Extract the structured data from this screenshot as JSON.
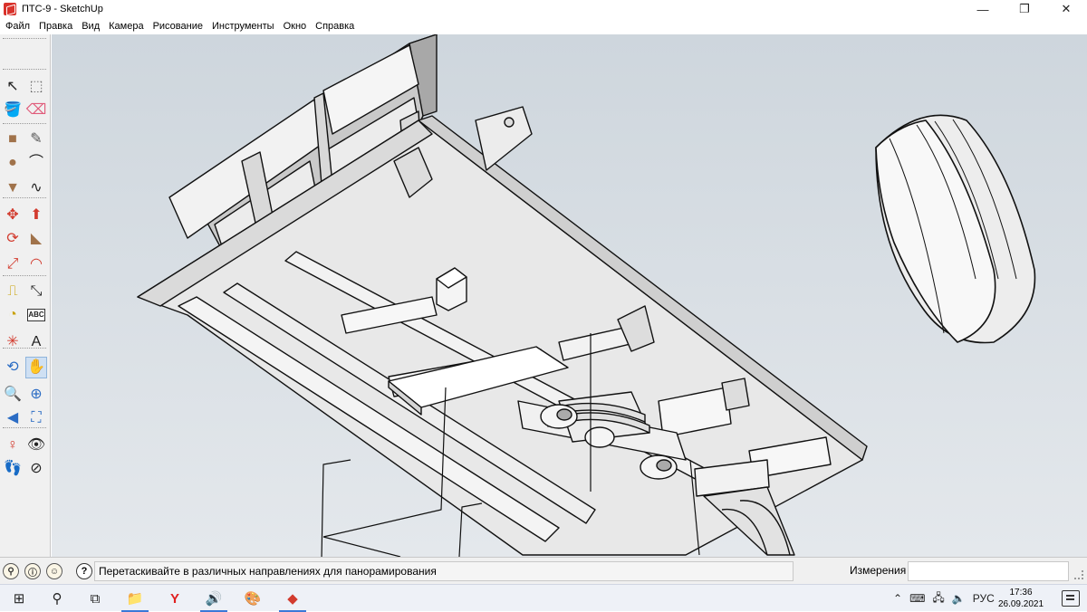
{
  "window": {
    "title": "ПТС-9 - SketchUp",
    "minimize_glyph": "—",
    "maximize_glyph": "❐",
    "close_glyph": "✕"
  },
  "menu": {
    "items": [
      "Файл",
      "Правка",
      "Вид",
      "Камера",
      "Рисование",
      "Инструменты",
      "Окно",
      "Справка"
    ]
  },
  "toolbar": {
    "tools": [
      {
        "name": "select-icon",
        "glyph": "↖",
        "color": "#222222"
      },
      {
        "name": "make-component-icon",
        "glyph": "⬚",
        "color": "#666666"
      },
      {
        "name": "paint-bucket-icon",
        "glyph": "🪣",
        "color": "#c8a000"
      },
      {
        "name": "eraser-icon",
        "glyph": "⌫",
        "color": "#e05b7a"
      },
      {
        "name": "rectangle-icon",
        "glyph": "■",
        "color": "#a0724a"
      },
      {
        "name": "line-pencil-icon",
        "glyph": "✎",
        "color": "#555555"
      },
      {
        "name": "circle-icon",
        "glyph": "●",
        "color": "#a0724a"
      },
      {
        "name": "arc-icon",
        "glyph": "⌒",
        "color": "#222222"
      },
      {
        "name": "polygon-icon",
        "glyph": "▼",
        "color": "#a0724a"
      },
      {
        "name": "freehand-icon",
        "glyph": "∿",
        "color": "#222222"
      },
      {
        "name": "move-icon",
        "glyph": "✥",
        "color": "#d23b2e"
      },
      {
        "name": "push-pull-icon",
        "glyph": "⬆",
        "color": "#d23b2e"
      },
      {
        "name": "rotate-icon",
        "glyph": "⟳",
        "color": "#d23b2e"
      },
      {
        "name": "follow-me-icon",
        "glyph": "◣",
        "color": "#a0724a"
      },
      {
        "name": "scale-icon",
        "glyph": "⤢",
        "color": "#d23b2e"
      },
      {
        "name": "offset-icon",
        "glyph": "◠",
        "color": "#d23b2e"
      },
      {
        "name": "tape-measure-icon",
        "glyph": "⎍",
        "color": "#c8a000"
      },
      {
        "name": "dimension-icon",
        "glyph": "⤡",
        "color": "#222222"
      },
      {
        "name": "protractor-icon",
        "glyph": "◔",
        "color": "#c8a000"
      },
      {
        "name": "text-icon",
        "glyph": "ABC",
        "color": "#222222"
      },
      {
        "name": "axes-icon",
        "glyph": "✳",
        "color": "#d23b2e"
      },
      {
        "name": "3d-text-icon",
        "glyph": "A",
        "color": "#222222"
      },
      {
        "name": "orbit-icon",
        "glyph": "⟲",
        "color": "#2b6cc4"
      },
      {
        "name": "pan-icon",
        "glyph": "✋",
        "color": "#222222"
      },
      {
        "name": "zoom-icon",
        "glyph": "🔍",
        "color": "#2b6cc4"
      },
      {
        "name": "zoom-window-icon",
        "glyph": "⊕",
        "color": "#2b6cc4"
      },
      {
        "name": "previous-view-icon",
        "glyph": "◀",
        "color": "#2b6cc4"
      },
      {
        "name": "zoom-extents-icon",
        "glyph": "⛶",
        "color": "#2b6cc4"
      },
      {
        "name": "position-camera-icon",
        "glyph": "♀",
        "color": "#d23b2e"
      },
      {
        "name": "look-around-icon",
        "glyph": "👁",
        "color": "#222222"
      },
      {
        "name": "walk-icon",
        "glyph": "👣",
        "color": "#222222"
      },
      {
        "name": "section-plane-icon",
        "glyph": "⊘",
        "color": "#222222"
      }
    ]
  },
  "status": {
    "message": "Перетаскивайте в различных направлениях для панорамирования",
    "help_glyph": "?",
    "measurements_label": "Измерения",
    "measurements_value": ""
  },
  "taskbar": {
    "apps": [
      {
        "name": "start-icon",
        "glyph": "⊞",
        "color": "#222222"
      },
      {
        "name": "search-icon",
        "glyph": "⚲",
        "color": "#222222"
      },
      {
        "name": "task-view-icon",
        "glyph": "⧉",
        "color": "#222222"
      },
      {
        "name": "file-explorer-icon",
        "glyph": "📁",
        "color": "#e0a800"
      },
      {
        "name": "yandex-browser-icon",
        "glyph": "Y",
        "color": "#e02020"
      },
      {
        "name": "volume-app-icon",
        "glyph": "🔊",
        "color": "#d23b2e"
      },
      {
        "name": "paint-app-icon",
        "glyph": "🎨",
        "color": "#4a8ad0"
      },
      {
        "name": "sketchup-taskbar-icon",
        "glyph": "◆",
        "color": "#d23b2e"
      }
    ],
    "tray_language": "РУС",
    "clock_time": "17:36",
    "clock_date": "26.09.2021"
  }
}
